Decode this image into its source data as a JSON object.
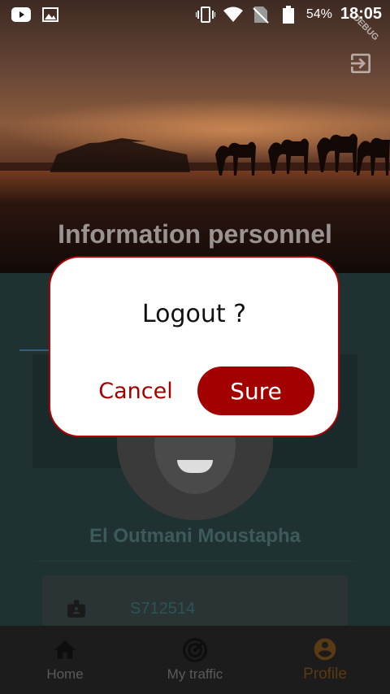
{
  "status_bar": {
    "battery": "54%",
    "time": "18:05",
    "icons": [
      "youtube-icon",
      "gallery-icon",
      "vibrate-icon",
      "wifi-icon",
      "no-sim-icon",
      "battery-icon"
    ]
  },
  "header": {
    "debug_banner": "DEBUG",
    "title": "Information personnel",
    "logout_icon": "logout-icon"
  },
  "profile": {
    "name": "El Outmani Moustapha",
    "id_value": "S712514",
    "id_icon": "badge-icon"
  },
  "dialog": {
    "title": "Logout ?",
    "cancel_label": "Cancel",
    "confirm_label": "Sure",
    "accent_color": "#a30000"
  },
  "bottom_nav": {
    "items": [
      {
        "label": "Home",
        "icon": "home-icon"
      },
      {
        "label": "My traffic",
        "icon": "traffic-icon"
      },
      {
        "label": "Profile",
        "icon": "profile-icon",
        "active": true
      }
    ]
  }
}
